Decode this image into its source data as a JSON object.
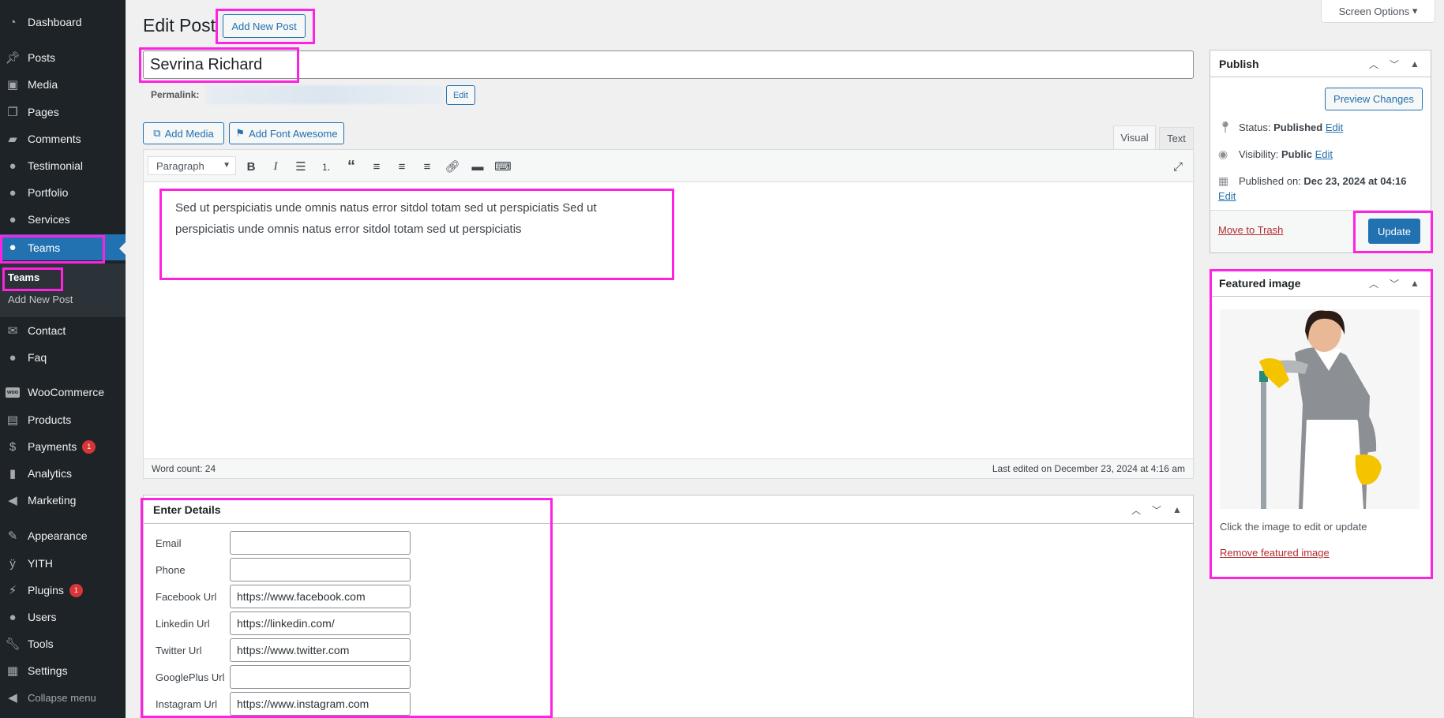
{
  "sidebar": {
    "items": [
      {
        "label": "Dashboard",
        "icon": "dashboard-icon"
      },
      {
        "label": "Posts",
        "icon": "pin-icon"
      },
      {
        "label": "Media",
        "icon": "media-icon"
      },
      {
        "label": "Pages",
        "icon": "pages-icon"
      },
      {
        "label": "Comments",
        "icon": "comment-icon"
      },
      {
        "label": "Testimonial",
        "icon": "person-icon"
      },
      {
        "label": "Portfolio",
        "icon": "person-icon"
      },
      {
        "label": "Services",
        "icon": "person-icon"
      },
      {
        "label": "Teams",
        "icon": "person-icon"
      },
      {
        "label": "Contact",
        "icon": "mail-icon"
      },
      {
        "label": "Faq",
        "icon": "person-icon"
      },
      {
        "label": "WooCommerce",
        "icon": "woo-icon"
      },
      {
        "label": "Products",
        "icon": "archive-icon"
      },
      {
        "label": "Payments",
        "icon": "payment-icon",
        "badge": "1"
      },
      {
        "label": "Analytics",
        "icon": "chart-icon"
      },
      {
        "label": "Marketing",
        "icon": "megaphone-icon"
      },
      {
        "label": "Appearance",
        "icon": "brush-icon"
      },
      {
        "label": "YITH",
        "icon": "yith-icon"
      },
      {
        "label": "Plugins",
        "icon": "plugin-icon",
        "badge": "1"
      },
      {
        "label": "Users",
        "icon": "user-icon"
      },
      {
        "label": "Tools",
        "icon": "wrench-icon"
      },
      {
        "label": "Settings",
        "icon": "settings-icon"
      }
    ],
    "submenu": [
      "Teams",
      "Add New Post"
    ],
    "collapse_label": "Collapse menu"
  },
  "header": {
    "screen_options": "Screen Options",
    "title": "Edit Post",
    "add_new": "Add New Post"
  },
  "post": {
    "title": "Sevrina Richard",
    "permalink_label": "Permalink:",
    "permalink_edit": "Edit"
  },
  "editor": {
    "add_media": "Add Media",
    "add_font_awesome": "Add Font Awesome",
    "tab_visual": "Visual",
    "tab_text": "Text",
    "format": "Paragraph",
    "content": "Sed ut perspiciatis unde omnis natus error sitdol totam sed ut perspiciatis Sed ut perspiciatis unde omnis natus error sitdol totam sed ut perspiciatis",
    "word_count": "Word count: 24",
    "last_edited": "Last edited on December 23, 2024 at 4:16 am"
  },
  "details": {
    "title": "Enter Details",
    "fields": [
      {
        "label": "Email",
        "value": ""
      },
      {
        "label": "Phone",
        "value": ""
      },
      {
        "label": "Facebook Url",
        "value": "https://www.facebook.com"
      },
      {
        "label": "Linkedin Url",
        "value": "https://linkedin.com/"
      },
      {
        "label": "Twitter Url",
        "value": "https://www.twitter.com"
      },
      {
        "label": "GooglePlus Url",
        "value": ""
      },
      {
        "label": "Instagram Url",
        "value": "https://www.instagram.com"
      }
    ]
  },
  "publish": {
    "title": "Publish",
    "preview": "Preview Changes",
    "status_label": "Status:",
    "status_value": "Published",
    "visibility_label": "Visibility:",
    "visibility_value": "Public",
    "published_label": "Published on:",
    "published_value": "Dec 23, 2024 at 04:16",
    "edit": "Edit",
    "trash": "Move to Trash",
    "update": "Update"
  },
  "featured": {
    "title": "Featured image",
    "caption": "Click the image to edit or update",
    "remove": "Remove featured image"
  },
  "colors": {
    "sidebar_bg": "#1d2327",
    "accent": "#2271b1",
    "highlight": "#ff22e0",
    "danger": "#b32d2e"
  }
}
